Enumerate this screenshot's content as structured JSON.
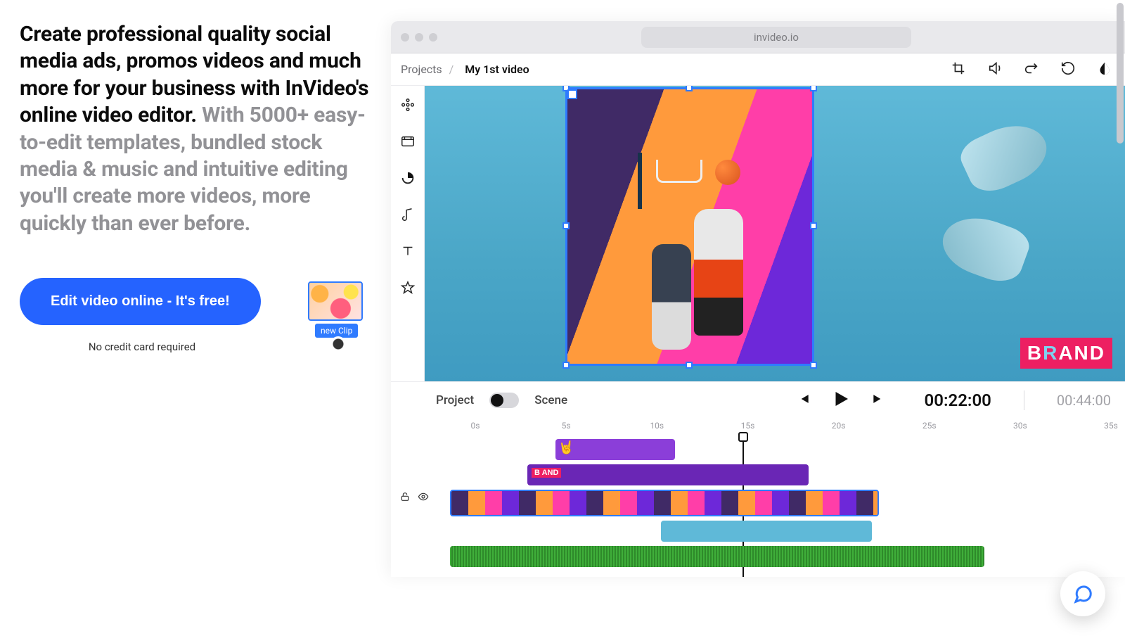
{
  "hero": {
    "headline_dark": "Create professional quality social media ads, promos videos and much more for your business with InVideo's online video editor.",
    "headline_gray": " With 5000+ easy-to-edit templates, bundled stock media & music and intuitive editing you'll create more videos, more quickly than ever before.",
    "cta_label": "Edit video online - It's free!",
    "no_card": "No credit card required"
  },
  "float_clip": {
    "badge": "new Clip"
  },
  "browser": {
    "url": "invideo.io"
  },
  "editor": {
    "breadcrumb_root": "Projects",
    "breadcrumb_sep": "/",
    "breadcrumb_current": "My 1st video",
    "brand_text_left": "B",
    "brand_text_r": "R",
    "brand_text_right": "AND",
    "playbar": {
      "project_label": "Project",
      "scene_label": "Scene",
      "time_current": "00:22:00",
      "time_total": "00:44:00"
    },
    "ruler": [
      "0s",
      "5s",
      "10s",
      "15s",
      "20s",
      "25s",
      "30s",
      "35s"
    ],
    "timeline_mini_brand": "B AND"
  },
  "colors": {
    "accent_blue": "#2563ff",
    "brand_pink": "#ed1f62"
  }
}
